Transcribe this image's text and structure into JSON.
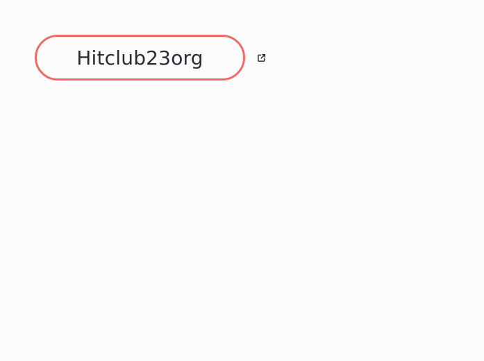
{
  "link": {
    "label": "Hitclub23org",
    "border_color": "#f06b68",
    "text_color": "#2b2b33"
  },
  "icons": {
    "external": "external-link-icon"
  },
  "background_color": "#fbfbfb"
}
